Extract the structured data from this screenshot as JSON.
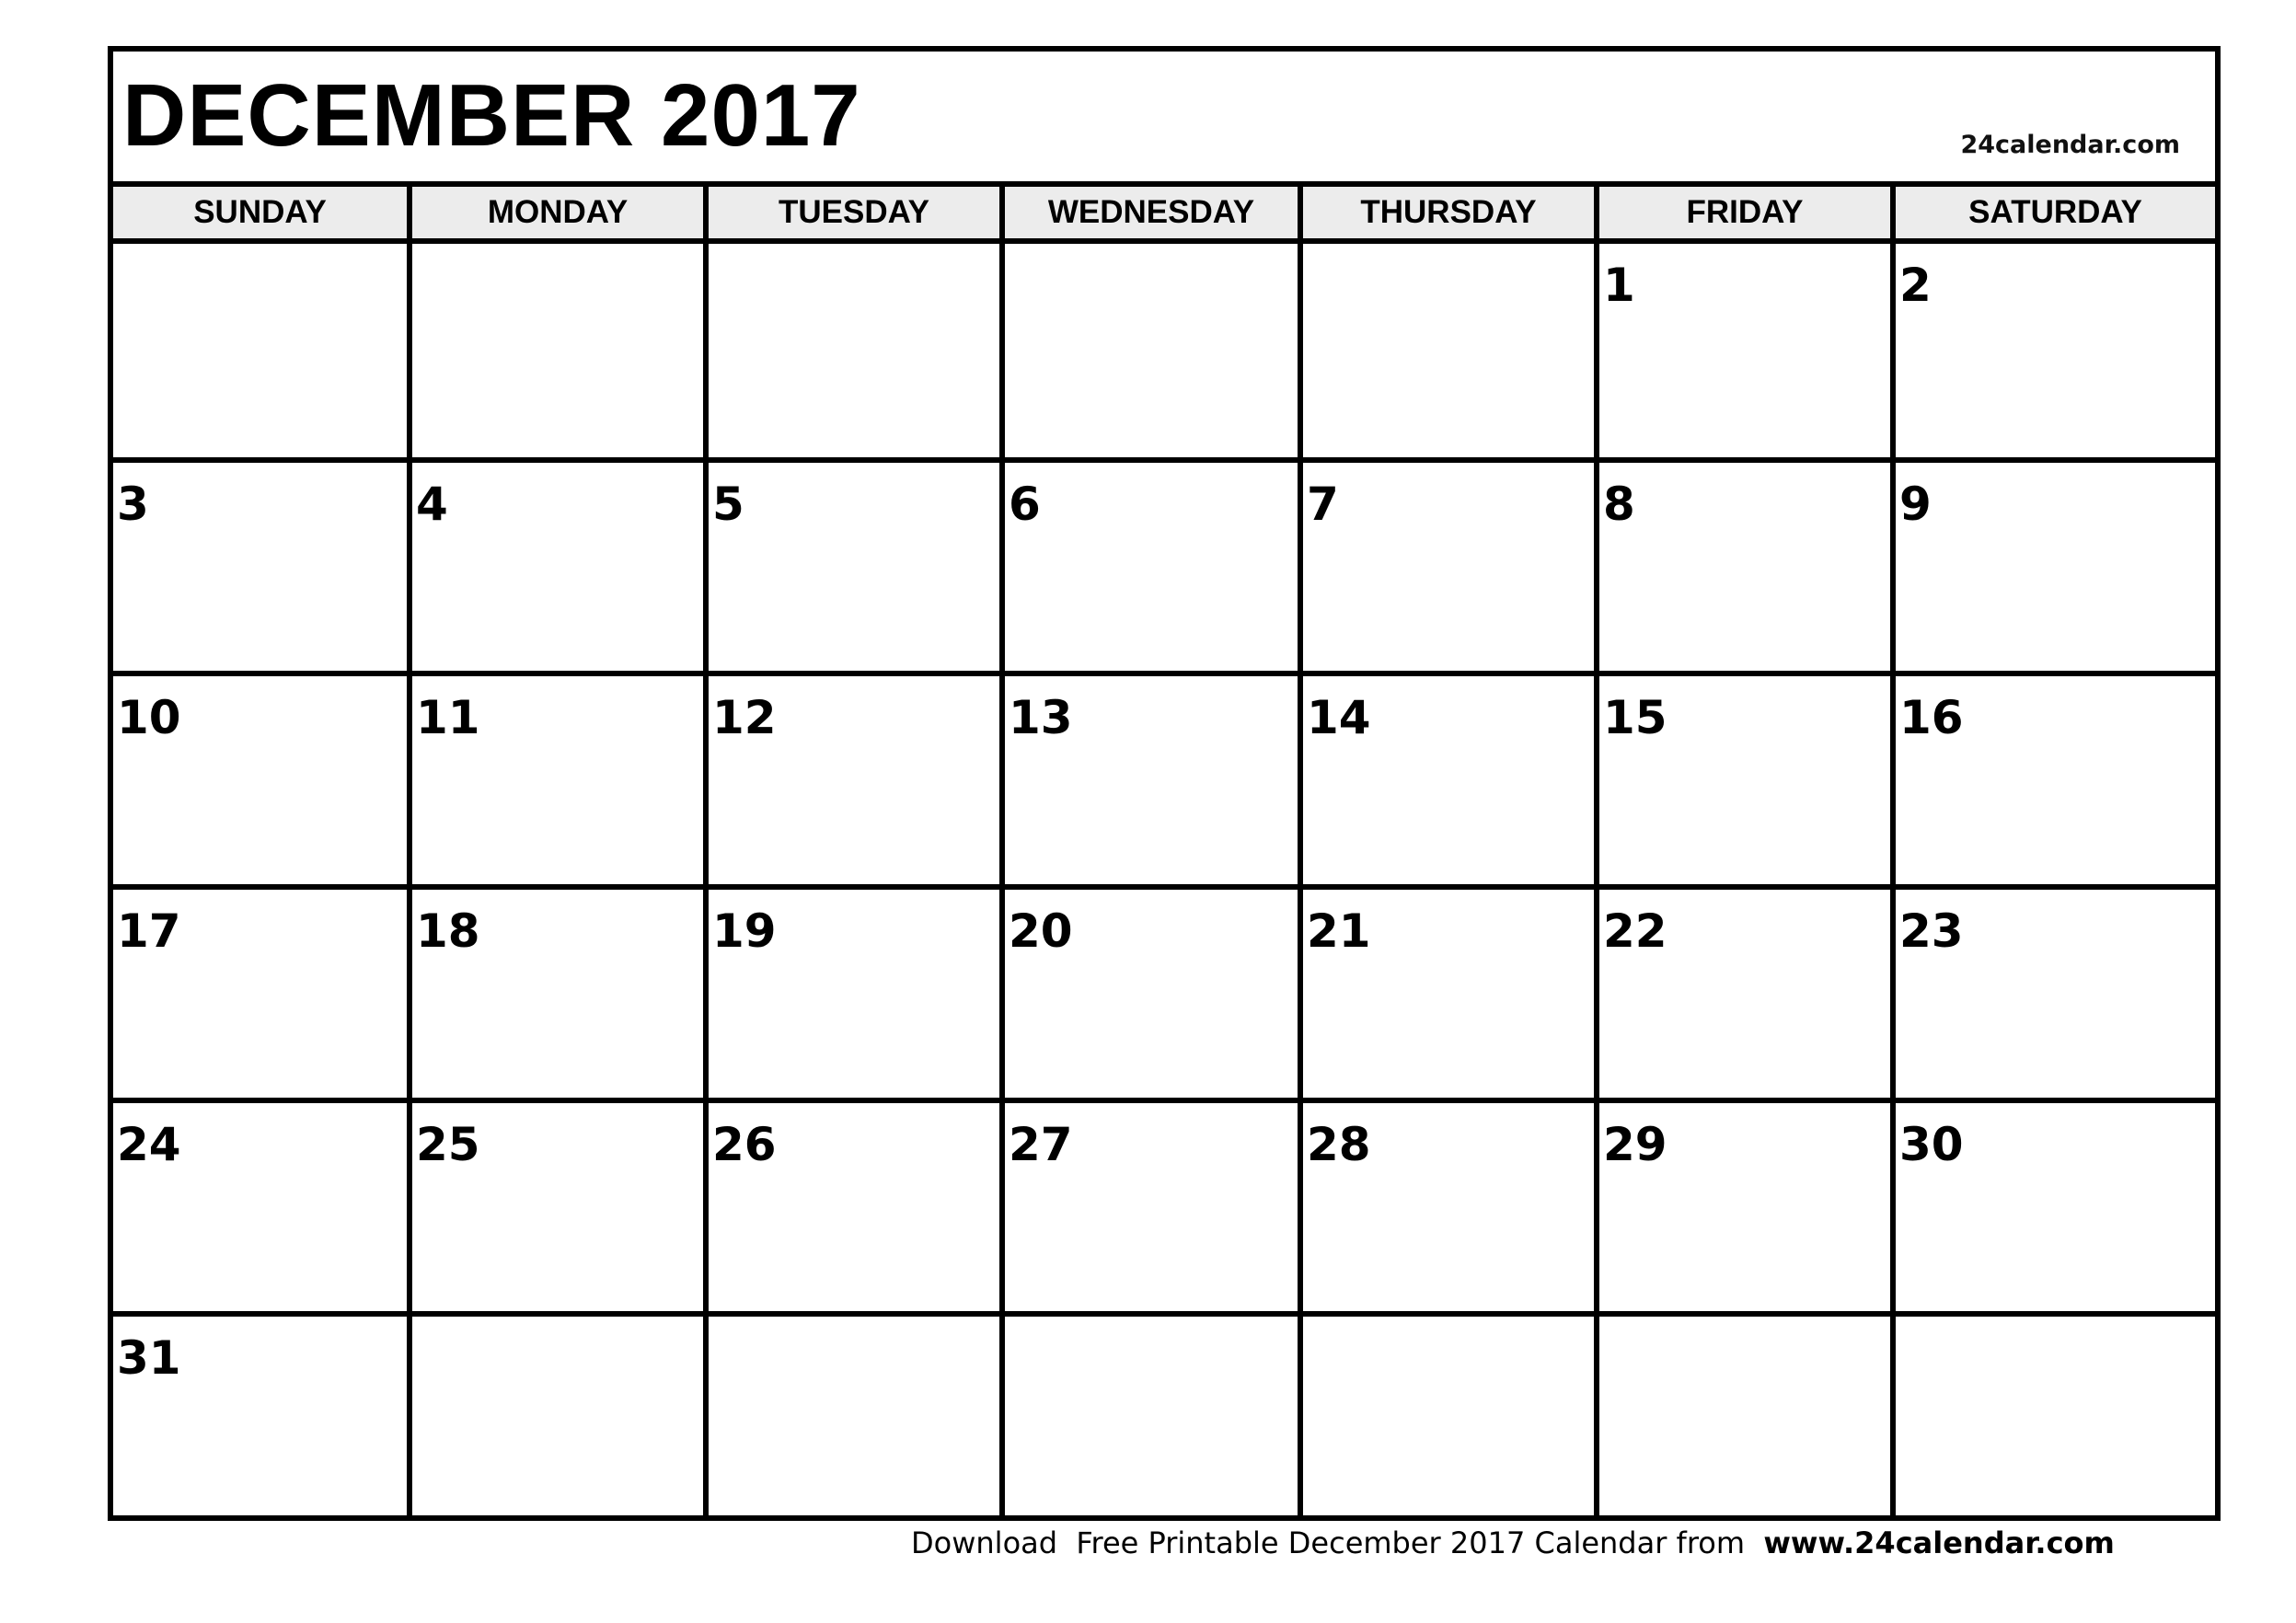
{
  "calendar": {
    "title": "DECEMBER 2017",
    "site_label": "24calendar.com",
    "weekdays": [
      "SUNDAY",
      "MONDAY",
      "TUESDAY",
      "WEDNESDAY",
      "THURSDAY",
      "FRIDAY",
      "SATURDAY"
    ],
    "weeks": [
      [
        "",
        "",
        "",
        "",
        "",
        "1",
        "2"
      ],
      [
        "3",
        "4",
        "5",
        "6",
        "7",
        "8",
        "9"
      ],
      [
        "10",
        "11",
        "12",
        "13",
        "14",
        "15",
        "16"
      ],
      [
        "17",
        "18",
        "19",
        "20",
        "21",
        "22",
        "23"
      ],
      [
        "24",
        "25",
        "26",
        "27",
        "28",
        "29",
        "30"
      ],
      [
        "31",
        "",
        "",
        "",
        "",
        "",
        ""
      ]
    ]
  },
  "footer": {
    "text": "Download  Free Printable December 2017 Calendar from  ",
    "url": "www.24calendar.com"
  },
  "colors": {
    "header_bg": "#ececec",
    "border": "#000000"
  }
}
